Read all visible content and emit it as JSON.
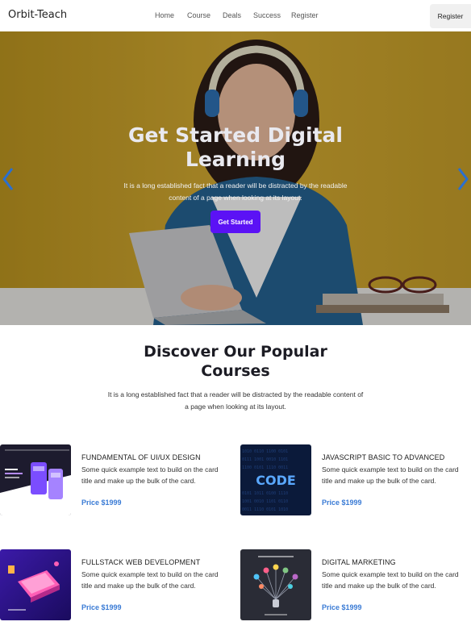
{
  "nav": {
    "brand": "Orbit-Teach",
    "links": [
      "Home",
      "Course",
      "Deals",
      "Success",
      "Register"
    ],
    "register_button": "Register"
  },
  "hero": {
    "title": "Get Started Digital Learning",
    "text": "It is a long established fact that a reader will be distracted by the readable content of a page when looking at its layout.",
    "button": "Get Started",
    "prev_icon": "chevron-left-icon",
    "next_icon": "chevron-right-icon"
  },
  "section": {
    "title": "Discover Our Popular Courses",
    "text": "It is a long established fact that a reader will be distracted by the readable content of a page when looking at its layout."
  },
  "courses": [
    {
      "title": "FUNDAMENTAL OF UI/UX DESIGN",
      "text": "Some quick example text to build on the card title and make up the bulk of the card.",
      "price": "Price $1999"
    },
    {
      "title": "JAVASCRIPT BASIC TO ADVANCED",
      "text": "Some quick example text to build on the card title and make up the bulk of the card.",
      "price": "Price $1999",
      "thumb_text": "CODE"
    },
    {
      "title": "FULLSTACK WEB DEVELOPMENT",
      "text": "Some quick example text to build on the card title and make up the bulk of the card.",
      "price": "Price $1999"
    },
    {
      "title": "DIGITAL MARKETING",
      "text": "Some quick example text to build on the card title and make up the bulk of the card.",
      "price": "Price $1999"
    }
  ],
  "colors": {
    "accent": "#5b12f5",
    "price": "#3a7bd5",
    "hero_bg": "#c19a27"
  }
}
